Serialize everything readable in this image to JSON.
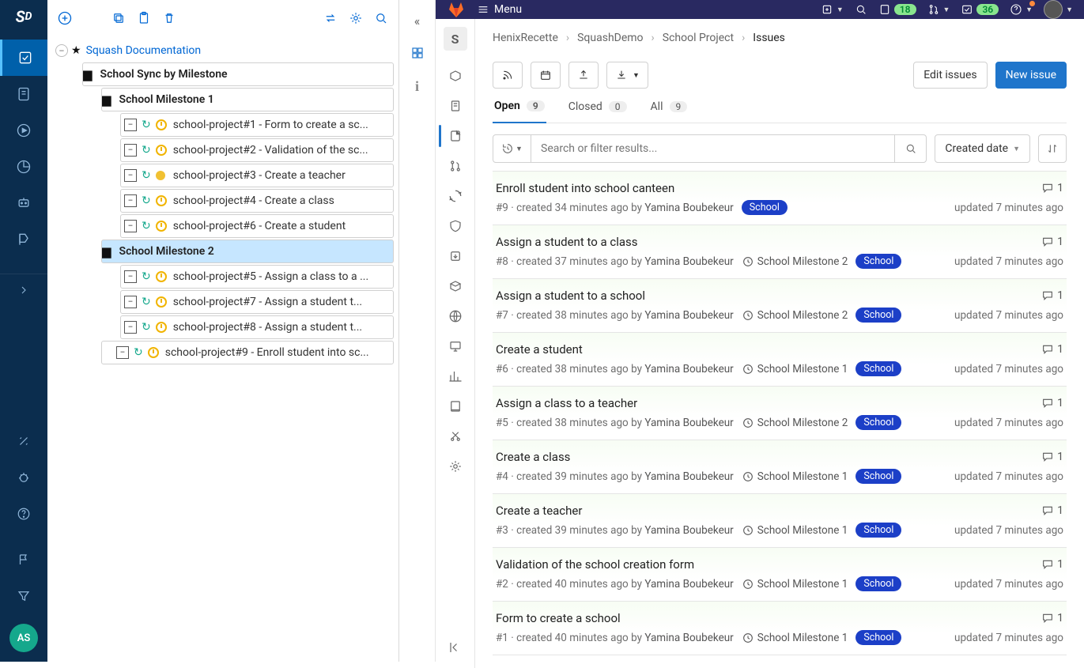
{
  "squash": {
    "avatar": "AS",
    "root_label": "Squash Documentation",
    "project_label": "School Sync by Milestone",
    "milestone1_label": "School Milestone 1",
    "milestone2_label": "School Milestone 2",
    "m1_items": [
      "school-project#1 - Form to create a sc...",
      "school-project#2 - Validation of the sc...",
      "school-project#3 - Create a teacher",
      "school-project#4 - Create a class",
      "school-project#6 - Create a student"
    ],
    "m2_items": [
      "school-project#5 - Assign a class to a ...",
      "school-project#7 - Assign a student t...",
      "school-project#8 - Assign a student t..."
    ],
    "loose_item": "school-project#9 - Enroll student into sc..."
  },
  "gutter": {
    "project_letter": "S"
  },
  "gitlab": {
    "menu": "Menu",
    "badge_issues": "18",
    "badge_todos": "36",
    "crumbs": [
      "HenixRecette",
      "SquashDemo",
      "School Project",
      "Issues"
    ],
    "project_letter": "S",
    "actions": {
      "edit": "Edit issues",
      "new": "New issue"
    },
    "tabs": {
      "open": {
        "label": "Open",
        "count": "9"
      },
      "closed": {
        "label": "Closed",
        "count": "0"
      },
      "all": {
        "label": "All",
        "count": "9"
      }
    },
    "search_placeholder": "Search or filter results...",
    "sort": "Created date",
    "issues": [
      {
        "title": "Enroll student into school canteen",
        "id": "#9",
        "created": "created 34 minutes ago by",
        "author": "Yamina Boubekeur",
        "milestone": "",
        "label": "School",
        "updated": "updated 7 minutes ago",
        "comments": "1"
      },
      {
        "title": "Assign a student to a class",
        "id": "#8",
        "created": "created 37 minutes ago by",
        "author": "Yamina Boubekeur",
        "milestone": "School Milestone 2",
        "label": "School",
        "updated": "updated 7 minutes ago",
        "comments": "1"
      },
      {
        "title": "Assign a student to a school",
        "id": "#7",
        "created": "created 38 minutes ago by",
        "author": "Yamina Boubekeur",
        "milestone": "School Milestone 2",
        "label": "School",
        "updated": "updated 7 minutes ago",
        "comments": "1"
      },
      {
        "title": "Create a student",
        "id": "#6",
        "created": "created 38 minutes ago by",
        "author": "Yamina Boubekeur",
        "milestone": "School Milestone 1",
        "label": "School",
        "updated": "updated 7 minutes ago",
        "comments": "1"
      },
      {
        "title": "Assign a class to a teacher",
        "id": "#5",
        "created": "created 38 minutes ago by",
        "author": "Yamina Boubekeur",
        "milestone": "School Milestone 2",
        "label": "School",
        "updated": "updated 7 minutes ago",
        "comments": "1"
      },
      {
        "title": "Create a class",
        "id": "#4",
        "created": "created 39 minutes ago by",
        "author": "Yamina Boubekeur",
        "milestone": "School Milestone 1",
        "label": "School",
        "updated": "updated 7 minutes ago",
        "comments": "1"
      },
      {
        "title": "Create a teacher",
        "id": "#3",
        "created": "created 39 minutes ago by",
        "author": "Yamina Boubekeur",
        "milestone": "School Milestone 1",
        "label": "School",
        "updated": "updated 7 minutes ago",
        "comments": "1"
      },
      {
        "title": "Validation of the school creation form",
        "id": "#2",
        "created": "created 40 minutes ago by",
        "author": "Yamina Boubekeur",
        "milestone": "School Milestone 1",
        "label": "School",
        "updated": "updated 7 minutes ago",
        "comments": "1"
      },
      {
        "title": "Form to create a school",
        "id": "#1",
        "created": "created 40 minutes ago by",
        "author": "Yamina Boubekeur",
        "milestone": "School Milestone 1",
        "label": "School",
        "updated": "updated 7 minutes ago",
        "comments": "1"
      }
    ]
  }
}
